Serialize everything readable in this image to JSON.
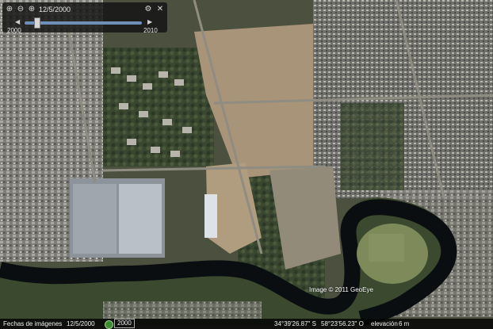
{
  "timebar": {
    "date": "12/5/2000",
    "start_year": "2000",
    "end_year": "2010",
    "icons": [
      "location-icon",
      "zoom-out-icon",
      "zoom-in-icon",
      "settings-icon",
      "close-icon"
    ],
    "slider_position": 0.11
  },
  "map": {
    "copyright": "Image © 2011 GeoEye"
  },
  "statusbar": {
    "imagery_label": "Fechas de imágenes",
    "imagery_date": "12/5/2000",
    "year": "2000",
    "latitude": "34°39'26.87\" S",
    "longitude": "58°23'56.23\" O",
    "elevation_label": "elevación",
    "elevation_value": "6 m"
  },
  "colors": {
    "river": "#0b0e10",
    "vegetation": "#3b4a2e",
    "settlement": "#8c8b84",
    "bare_soil": "#a89479",
    "slider_track": "#6d8fb8"
  }
}
